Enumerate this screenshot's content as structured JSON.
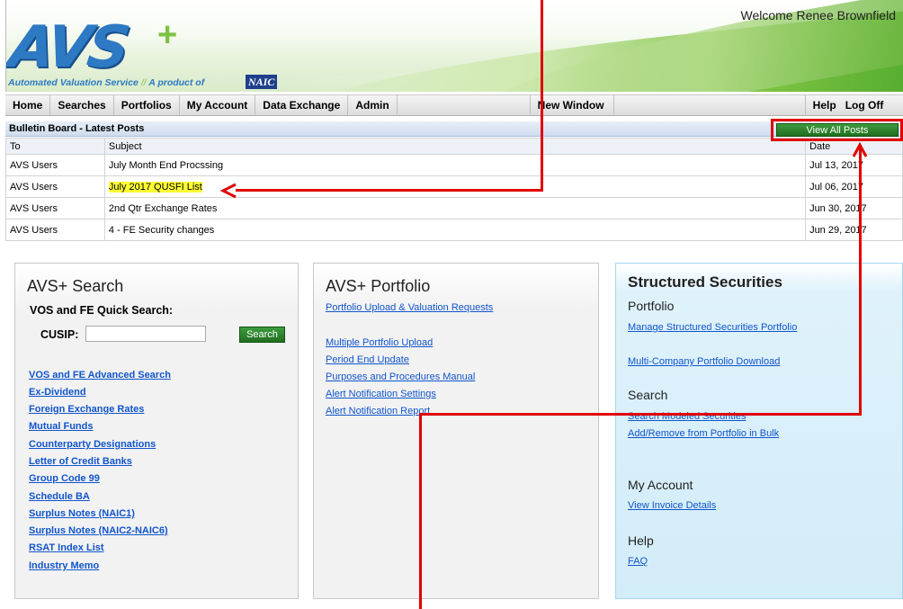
{
  "header": {
    "logo": "AVS+",
    "tagline_main": "Automated Valuation Service",
    "tagline_sep": "//",
    "tagline_product": "A product of",
    "naic": "NAIC",
    "welcome": "Welcome Renee Brownfield"
  },
  "nav": {
    "items": [
      "Home",
      "Searches",
      "Portfolios",
      "My Account",
      "Data Exchange",
      "Admin"
    ],
    "new_window": "New Window",
    "help": "Help",
    "logoff": "Log Off"
  },
  "bulletin": {
    "title": "Bulletin Board - Latest Posts",
    "view_all": "View All Posts",
    "columns": [
      "To",
      "Subject",
      "Date"
    ],
    "rows": [
      {
        "to": "AVS Users",
        "subject": "July Month End Procssing",
        "date": "Jul 13, 2017"
      },
      {
        "to": "AVS Users",
        "subject": "July 2017 QUSFI List",
        "date": "Jul 06, 2017"
      },
      {
        "to": "AVS Users",
        "subject": "2nd Qtr Exchange Rates",
        "date": "Jun 30, 2017"
      },
      {
        "to": "AVS Users",
        "subject": "4 - FE Security changes",
        "date": "Jun 29, 2017"
      }
    ]
  },
  "search_panel": {
    "title": "AVS+ Search",
    "quick": "VOS and FE Quick Search:",
    "cusip_label": "CUSIP:",
    "cusip_value": "",
    "search_button": "Search",
    "links": [
      "VOS and FE Advanced Search",
      "Ex-Dividend",
      "Foreign Exchange Rates",
      "Mutual Funds",
      "Counterparty Designations",
      "Letter of Credit Banks",
      "Group Code 99",
      "Schedule BA",
      "Surplus Notes (NAIC1)",
      "Surplus Notes (NAIC2-NAIC6)",
      "RSAT Index List",
      "Industry Memo"
    ]
  },
  "portfolio_panel": {
    "title": "AVS+ Portfolio",
    "links": [
      "Portfolio Upload & Valuation Requests",
      "Multiple Portfolio Upload",
      "Period End Update",
      "Purposes and Procedures Manual",
      "Alert Notification Settings",
      "Alert Notification Report"
    ]
  },
  "structured_panel": {
    "title": "Structured Securities",
    "portfolio_heading": "Portfolio",
    "portfolio_links": [
      "Manage Structured Securities Portfolio",
      "Multi-Company Portfolio Download"
    ],
    "search_heading": "Search",
    "search_links": [
      "Search Modeled Securities",
      "Add/Remove from Portfolio in Bulk"
    ],
    "account_heading": "My Account",
    "account_links": [
      "View Invoice Details"
    ],
    "help_heading": "Help",
    "help_links": [
      "FAQ"
    ]
  },
  "colors": {
    "accent_blue": "#2d79c4",
    "brand_green": "#7cc242",
    "button_green": "#1f6f1f",
    "link": "#1155cc",
    "highlight": "#ffff33",
    "annotation_red": "#e00000"
  }
}
